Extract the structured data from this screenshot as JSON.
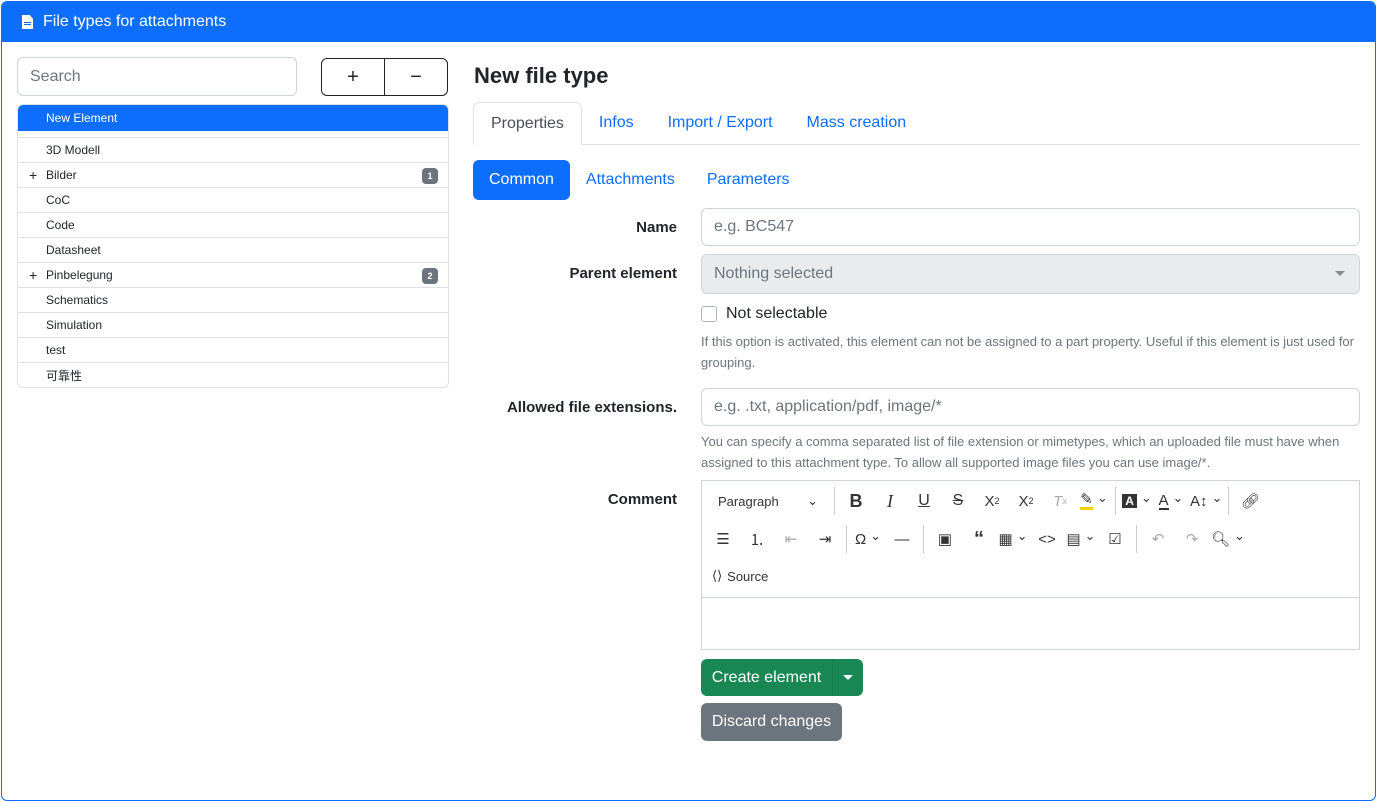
{
  "header": {
    "title": "File types for attachments"
  },
  "sidebar": {
    "search_placeholder": "Search",
    "add_label": "+",
    "remove_label": "−",
    "active_item": "New Element",
    "items": [
      {
        "label": "3D Modell"
      },
      {
        "label": "Bilder",
        "expandable": true,
        "count": "1"
      },
      {
        "label": "CoC"
      },
      {
        "label": "Code"
      },
      {
        "label": "Datasheet"
      },
      {
        "label": "Pinbelegung",
        "expandable": true,
        "count": "2"
      },
      {
        "label": "Schematics"
      },
      {
        "label": "Simulation"
      },
      {
        "label": "test"
      },
      {
        "label": "可靠性"
      }
    ]
  },
  "main": {
    "title": "New file type",
    "tabs": [
      "Properties",
      "Infos",
      "Import / Export",
      "Mass creation"
    ],
    "pills": [
      "Common",
      "Attachments",
      "Parameters"
    ],
    "form": {
      "name_label": "Name",
      "name_placeholder": "e.g. BC547",
      "parent_label": "Parent element",
      "parent_value": "Nothing selected",
      "not_selectable_label": "Not selectable",
      "not_selectable_help": "If this option is activated, this element can not be assigned to a part property. Useful if this element is just used for grouping.",
      "extensions_label": "Allowed file extensions.",
      "extensions_placeholder": "e.g. .txt, application/pdf, image/*",
      "extensions_help": "You can specify a comma separated list of file extension or mimetypes, which an uploaded file must have when assigned to this attachment type. To allow all supported image files you can use image/*.",
      "comment_label": "Comment",
      "editor_paragraph": "Paragraph",
      "editor_source": "Source"
    },
    "create_label": "Create element",
    "discard_label": "Discard changes"
  },
  "colors": {
    "primary": "#0d6efd",
    "success": "#198754",
    "secondary": "#6c757d"
  }
}
